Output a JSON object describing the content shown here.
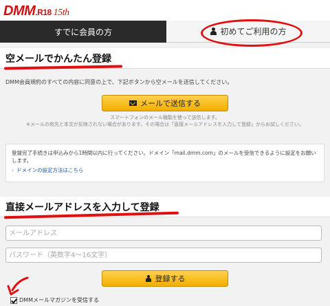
{
  "header": {
    "logo_text": "DMM",
    "logo_suffix": ".R18",
    "logo_anniv": "15th",
    "brand_color": "#d01010"
  },
  "tabs": {
    "login_label": "すでに会員の方",
    "first_label": "初めてご利用の方"
  },
  "quick_signup": {
    "title": "空メールでかんたん登録",
    "agree_text": "DMM会員規約のすべての内容に同意の上で、下記ボタンから空メールを送信してください。",
    "mail_button_label": "メールで送信する",
    "note_line1": "スマートフォンのメール機能を使って送信します。",
    "note_line2": "※メールの宛先と本文が反映されない場合があります。その場合は「直接メールアドレスを入力して登録」からお試しください。",
    "info_text": "登録完了手続きは申込みから1時間以内に行ってください。ドメイン「mail.dmm.com」のメールを受信できるように設定をお願いします。",
    "info_link": "ドメインの設定方法はこちら"
  },
  "direct_signup": {
    "title": "直接メールアドレスを入力して登録",
    "email_placeholder": "メールアドレス",
    "password_placeholder": "パスワード（英数字4～16文字）",
    "register_button_label": "登録する",
    "newsletter_label": "DMMメールマガジンを受信する",
    "newsletter_checked": true
  },
  "colors": {
    "accent_gold": "#f2ae00",
    "annotation_red": "#e01010",
    "tab_dark": "#2a2a2a"
  }
}
